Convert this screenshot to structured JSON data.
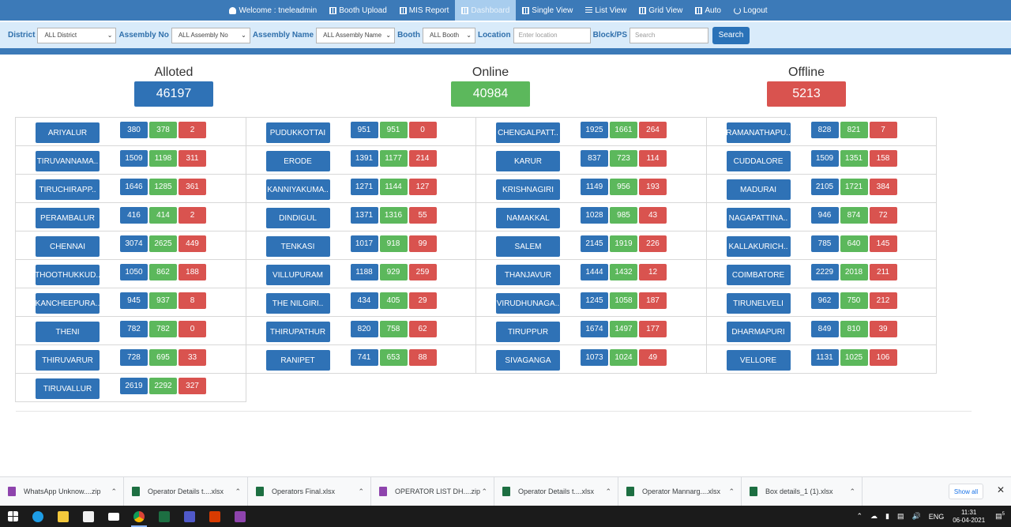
{
  "nav": {
    "items": [
      {
        "icon": "user-icon",
        "label": "Welcome : tneleadmin",
        "active": false
      },
      {
        "icon": "upload-icon",
        "label": "Booth Upload",
        "active": false
      },
      {
        "icon": "report-icon",
        "label": "MIS Report",
        "active": false
      },
      {
        "icon": "dashboard-icon",
        "label": "Dashboard",
        "active": true
      },
      {
        "icon": "single-view-icon",
        "label": "Single View",
        "active": false
      },
      {
        "icon": "list-view-icon",
        "label": "List View",
        "active": false
      },
      {
        "icon": "grid-view-icon",
        "label": "Grid View",
        "active": false
      },
      {
        "icon": "auto-icon",
        "label": "Auto",
        "active": false
      },
      {
        "icon": "power-icon",
        "label": "Logout",
        "active": false
      }
    ]
  },
  "filters": {
    "district_label": "District",
    "district_value": "ALL District",
    "assembly_no_label": "Assembly No",
    "assembly_no_value": "ALL Assembly No",
    "assembly_name_label": "Assembly Name",
    "assembly_name_value": "ALL Assembly Name",
    "booth_label": "Booth",
    "booth_value": "ALL Booth",
    "location_label": "Location",
    "location_placeholder": "Enter location",
    "block_label": "Block/PS",
    "block_placeholder": "Search",
    "search_button": "Search"
  },
  "summary": {
    "allotted_label": "Alloted",
    "allotted_value": "46197",
    "online_label": "Online",
    "online_value": "40984",
    "offline_label": "Offline",
    "offline_value": "5213"
  },
  "colors": {
    "allotted": "#2f72b6",
    "online": "#5cb85c",
    "offline": "#d9534f",
    "nav": "#3c7ab8"
  },
  "districts": [
    {
      "name": "ARIYALUR",
      "allotted": "380",
      "online": "378",
      "offline": "2"
    },
    {
      "name": "PUDUKKOTTAI",
      "allotted": "951",
      "online": "951",
      "offline": "0"
    },
    {
      "name": "CHENGALPATT..",
      "allotted": "1925",
      "online": "1661",
      "offline": "264"
    },
    {
      "name": "RAMANATHAPU..",
      "allotted": "828",
      "online": "821",
      "offline": "7"
    },
    {
      "name": "TIRUVANNAMA..",
      "allotted": "1509",
      "online": "1198",
      "offline": "311"
    },
    {
      "name": "ERODE",
      "allotted": "1391",
      "online": "1177",
      "offline": "214"
    },
    {
      "name": "KARUR",
      "allotted": "837",
      "online": "723",
      "offline": "114"
    },
    {
      "name": "CUDDALORE",
      "allotted": "1509",
      "online": "1351",
      "offline": "158"
    },
    {
      "name": "TIRUCHIRAPP..",
      "allotted": "1646",
      "online": "1285",
      "offline": "361"
    },
    {
      "name": "KANNIYAKUMA..",
      "allotted": "1271",
      "online": "1144",
      "offline": "127"
    },
    {
      "name": "KRISHNAGIRI",
      "allotted": "1149",
      "online": "956",
      "offline": "193"
    },
    {
      "name": "MADURAI",
      "allotted": "2105",
      "online": "1721",
      "offline": "384"
    },
    {
      "name": "PERAMBALUR",
      "allotted": "416",
      "online": "414",
      "offline": "2"
    },
    {
      "name": "DINDIGUL",
      "allotted": "1371",
      "online": "1316",
      "offline": "55"
    },
    {
      "name": "NAMAKKAL",
      "allotted": "1028",
      "online": "985",
      "offline": "43"
    },
    {
      "name": "NAGAPATTINA..",
      "allotted": "946",
      "online": "874",
      "offline": "72"
    },
    {
      "name": "CHENNAI",
      "allotted": "3074",
      "online": "2625",
      "offline": "449"
    },
    {
      "name": "TENKASI",
      "allotted": "1017",
      "online": "918",
      "offline": "99"
    },
    {
      "name": "SALEM",
      "allotted": "2145",
      "online": "1919",
      "offline": "226"
    },
    {
      "name": "KALLAKURICH..",
      "allotted": "785",
      "online": "640",
      "offline": "145"
    },
    {
      "name": "THOOTHUKKUD..",
      "allotted": "1050",
      "online": "862",
      "offline": "188"
    },
    {
      "name": "VILLUPURAM",
      "allotted": "1188",
      "online": "929",
      "offline": "259"
    },
    {
      "name": "THANJAVUR",
      "allotted": "1444",
      "online": "1432",
      "offline": "12"
    },
    {
      "name": "COIMBATORE",
      "allotted": "2229",
      "online": "2018",
      "offline": "211"
    },
    {
      "name": "KANCHEEPURA..",
      "allotted": "945",
      "online": "937",
      "offline": "8"
    },
    {
      "name": "THE NILGIRI..",
      "allotted": "434",
      "online": "405",
      "offline": "29"
    },
    {
      "name": "VIRUDHUNAGA..",
      "allotted": "1245",
      "online": "1058",
      "offline": "187"
    },
    {
      "name": "TIRUNELVELI",
      "allotted": "962",
      "online": "750",
      "offline": "212"
    },
    {
      "name": "THENI",
      "allotted": "782",
      "online": "782",
      "offline": "0"
    },
    {
      "name": "THIRUPATHUR",
      "allotted": "820",
      "online": "758",
      "offline": "62"
    },
    {
      "name": "TIRUPPUR",
      "allotted": "1674",
      "online": "1497",
      "offline": "177"
    },
    {
      "name": "DHARMAPURI",
      "allotted": "849",
      "online": "810",
      "offline": "39"
    },
    {
      "name": "THIRUVARUR",
      "allotted": "728",
      "online": "695",
      "offline": "33"
    },
    {
      "name": "RANIPET",
      "allotted": "741",
      "online": "653",
      "offline": "88"
    },
    {
      "name": "SIVAGANGA",
      "allotted": "1073",
      "online": "1024",
      "offline": "49"
    },
    {
      "name": "VELLORE",
      "allotted": "1131",
      "online": "1025",
      "offline": "106"
    },
    {
      "name": "TIRUVALLUR",
      "allotted": "2619",
      "online": "2292",
      "offline": "327"
    }
  ],
  "downloads": {
    "items": [
      {
        "name": "WhatsApp Unknow....zip",
        "type": "zip"
      },
      {
        "name": "Operator Details t....xlsx",
        "type": "xlsx"
      },
      {
        "name": "Operators Final.xlsx",
        "type": "xlsx"
      },
      {
        "name": "OPERATOR LIST DH....zip",
        "type": "zip"
      },
      {
        "name": "Operator Details t....xlsx",
        "type": "xlsx"
      },
      {
        "name": "Operator Mannarg....xlsx",
        "type": "xlsx"
      },
      {
        "name": "Box details_1 (1).xlsx",
        "type": "xlsx"
      }
    ],
    "show_all": "Show all"
  },
  "taskbar": {
    "language": "ENG",
    "time": "11:31",
    "date": "06-04-2021",
    "notifications": "5"
  }
}
